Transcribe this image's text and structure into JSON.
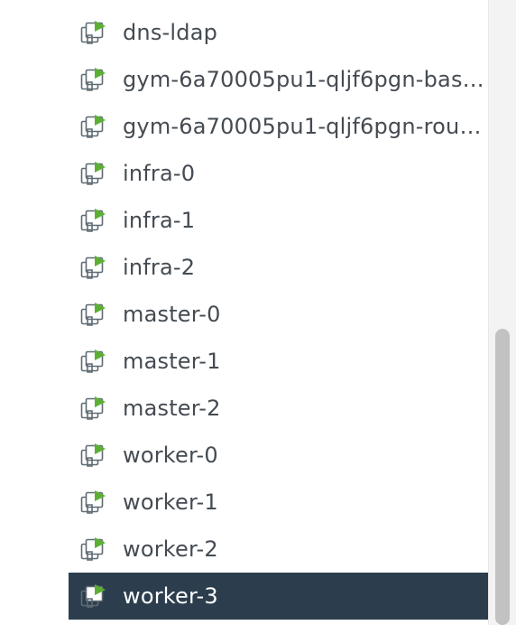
{
  "tree": {
    "items": [
      {
        "label": "dns-ldap",
        "icon": "vm-powered-on-icon",
        "selected": false
      },
      {
        "label": "gym-6a70005pu1-qljf6pgn-bas…",
        "icon": "vm-powered-on-icon",
        "selected": false
      },
      {
        "label": "gym-6a70005pu1-qljf6pgn-rou…",
        "icon": "vm-powered-on-icon",
        "selected": false
      },
      {
        "label": "infra-0",
        "icon": "vm-powered-on-icon",
        "selected": false
      },
      {
        "label": "infra-1",
        "icon": "vm-powered-on-icon",
        "selected": false
      },
      {
        "label": "infra-2",
        "icon": "vm-powered-on-icon",
        "selected": false
      },
      {
        "label": "master-0",
        "icon": "vm-powered-on-icon",
        "selected": false
      },
      {
        "label": "master-1",
        "icon": "vm-powered-on-icon",
        "selected": false
      },
      {
        "label": "master-2",
        "icon": "vm-powered-on-icon",
        "selected": false
      },
      {
        "label": "worker-0",
        "icon": "vm-powered-on-icon",
        "selected": false
      },
      {
        "label": "worker-1",
        "icon": "vm-powered-on-icon",
        "selected": false
      },
      {
        "label": "worker-2",
        "icon": "vm-powered-on-icon",
        "selected": false
      },
      {
        "label": "worker-3",
        "icon": "vm-powered-on-icon",
        "selected": true
      }
    ]
  },
  "colors": {
    "selected_background": "#2c3e4e",
    "text": "#444b52",
    "selected_text": "#ffffff",
    "power_on_green": "#5bb033",
    "scrollbar_thumb": "#c2c2c2"
  }
}
